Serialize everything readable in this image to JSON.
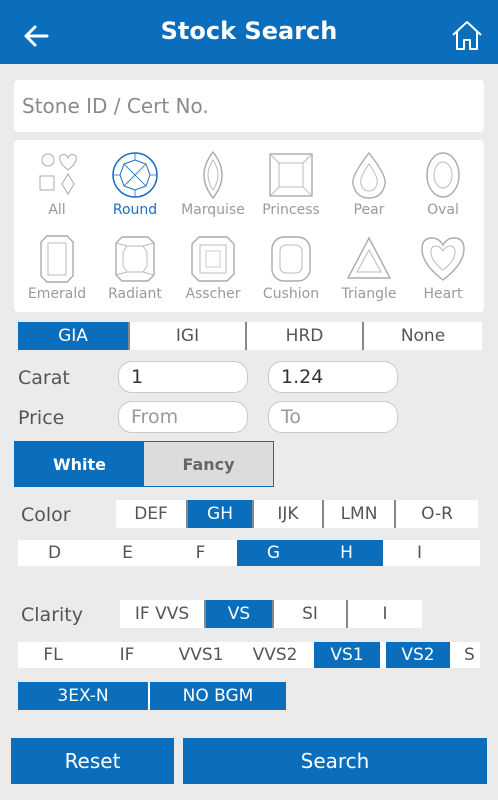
{
  "header": {
    "title": "Stock Search",
    "back_icon": "arrow-left-icon",
    "home_icon": "home-icon"
  },
  "search": {
    "placeholder": "Stone ID / Cert No."
  },
  "shapes": [
    {
      "label": "All",
      "icon": "all-shapes-icon",
      "selected": false
    },
    {
      "label": "Round",
      "icon": "round-icon",
      "selected": true
    },
    {
      "label": "Marquise",
      "icon": "marquise-icon",
      "selected": false
    },
    {
      "label": "Princess",
      "icon": "princess-icon",
      "selected": false
    },
    {
      "label": "Pear",
      "icon": "pear-icon",
      "selected": false
    },
    {
      "label": "Oval",
      "icon": "oval-icon",
      "selected": false
    },
    {
      "label": "Emerald",
      "icon": "emerald-icon",
      "selected": false
    },
    {
      "label": "Radiant",
      "icon": "radiant-icon",
      "selected": false
    },
    {
      "label": "Asscher",
      "icon": "asscher-icon",
      "selected": false
    },
    {
      "label": "Cushion",
      "icon": "cushion-icon",
      "selected": false
    },
    {
      "label": "Triangle",
      "icon": "triangle-icon",
      "selected": false
    },
    {
      "label": "Heart",
      "icon": "heart-icon",
      "selected": false
    }
  ],
  "labs": [
    {
      "label": "GIA",
      "selected": true
    },
    {
      "label": "IGI",
      "selected": false
    },
    {
      "label": "HRD",
      "selected": false
    },
    {
      "label": "None",
      "selected": false
    }
  ],
  "carat": {
    "label": "Carat",
    "from": "1",
    "to": "1.24"
  },
  "price": {
    "label": "Price",
    "from_placeholder": "From",
    "to_placeholder": "To"
  },
  "type_toggle": [
    {
      "label": "White",
      "selected": true
    },
    {
      "label": "Fancy",
      "selected": false
    }
  ],
  "color": {
    "label": "Color",
    "groups": [
      {
        "label": "DEF",
        "selected": false
      },
      {
        "label": "GH",
        "selected": true
      },
      {
        "label": "IJK",
        "selected": false
      },
      {
        "label": "LMN",
        "selected": false
      },
      {
        "label": "O-R",
        "selected": false
      }
    ],
    "grades": [
      {
        "label": "D",
        "selected": false
      },
      {
        "label": "E",
        "selected": false
      },
      {
        "label": "F",
        "selected": false
      },
      {
        "label": "G",
        "selected": true
      },
      {
        "label": "H",
        "selected": true
      },
      {
        "label": "I",
        "selected": false
      }
    ]
  },
  "clarity": {
    "label": "Clarity",
    "groups": [
      {
        "label": "IF VVS",
        "selected": false
      },
      {
        "label": "VS",
        "selected": true
      },
      {
        "label": "SI",
        "selected": false
      },
      {
        "label": "I",
        "selected": false
      }
    ],
    "grades": [
      {
        "label": "FL",
        "selected": false
      },
      {
        "label": "IF",
        "selected": false
      },
      {
        "label": "VVS1",
        "selected": false
      },
      {
        "label": "VVS2",
        "selected": false
      },
      {
        "label": "VS1",
        "selected": true
      },
      {
        "label": "VS2",
        "selected": true
      },
      {
        "label": "S",
        "selected": false
      }
    ]
  },
  "extras": [
    {
      "label": "3EX-N",
      "selected": true
    },
    {
      "label": "NO BGM",
      "selected": true
    }
  ],
  "actions": {
    "reset": "Reset",
    "search": "Search"
  },
  "colors": {
    "brand": "#0a6ebd",
    "background": "#ebebeb"
  }
}
